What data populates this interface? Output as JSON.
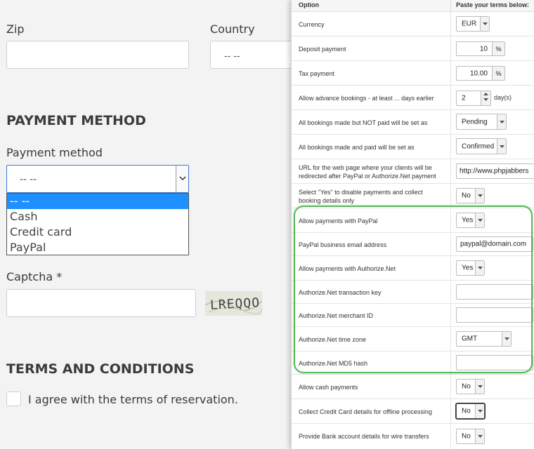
{
  "form": {
    "zip_label": "Zip",
    "country_label": "Country",
    "country_value": "-- --",
    "payment_section_title": "PAYMENT METHOD",
    "payment_method_label": "Payment method",
    "payment_method_value": "-- --",
    "payment_options": [
      "-- --",
      "Cash",
      "Credit card",
      "PayPal"
    ],
    "captcha_label": "Captcha *",
    "captcha_text": "LREQQO",
    "terms_section_title": "TERMS AND CONDITIONS",
    "terms_checkbox_label": "I agree with the terms of reservation."
  },
  "panel": {
    "header_option": "Option",
    "header_terms": "Paste your terms below:",
    "rows": [
      {
        "label": "Currency",
        "value": "EUR"
      },
      {
        "label": "Deposit payment",
        "value": "10",
        "unit": "%"
      },
      {
        "label": "Tax payment",
        "value": "10.00",
        "unit": "%"
      },
      {
        "label": "Allow advance bookings - at least ... days earlier",
        "value": "2",
        "unit": "day(s)"
      },
      {
        "label": "All bookings made but NOT paid will be set as",
        "value": "Pending"
      },
      {
        "label": "All bookings made and paid will be set as",
        "value": "Confirmed"
      },
      {
        "label": "URL for the web page where your clients will be redirected after PayPal or Authorize.Net payment",
        "value": "http://www.phpjabbers"
      },
      {
        "label": "Select \"Yes\" to disable payments and collect booking details only",
        "value": "No"
      },
      {
        "label": "Allow payments with PayPal",
        "value": "Yes"
      },
      {
        "label": "PayPal business email address",
        "value": "paypal@domain.com"
      },
      {
        "label": "Allow payments with Authorize.Net",
        "value": "Yes"
      },
      {
        "label": "Authorize.Net transaction key",
        "value": ""
      },
      {
        "label": "Authorize.Net merchant ID",
        "value": ""
      },
      {
        "label": "Authorize.Net time zone",
        "value": "GMT"
      },
      {
        "label": "Authorize.Net MD5 hash",
        "value": ""
      },
      {
        "label": "Allow cash payments",
        "value": "No"
      },
      {
        "label": "Collect Credit Card details for offline processing",
        "value": "No"
      },
      {
        "label": "Provide Bank account details for wire transfers",
        "value": "No"
      }
    ]
  },
  "colors": {
    "highlight_border": "#5ab85a",
    "selected_option": "#1e90ff",
    "focus_border": "#3a7bd5"
  }
}
